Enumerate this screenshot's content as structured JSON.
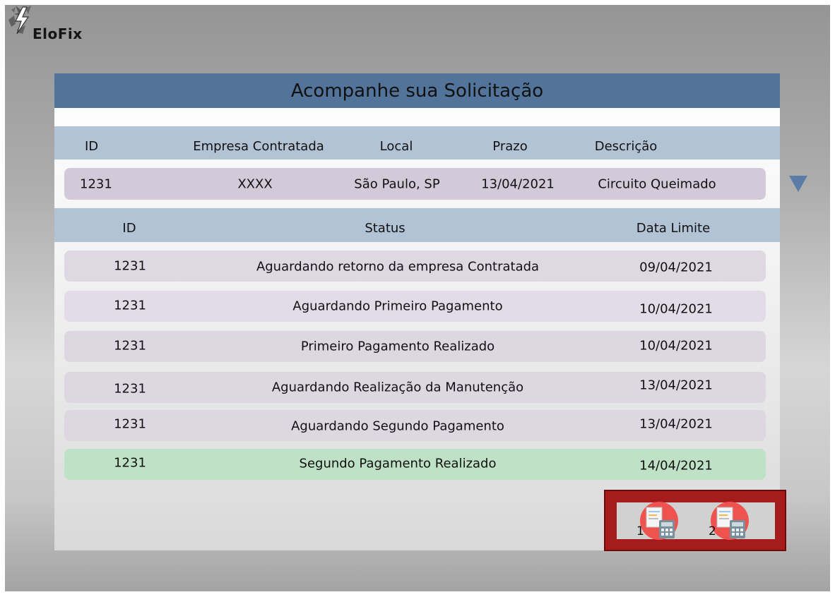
{
  "brand": {
    "name": "EloFix",
    "logo_icon": "lightning-bolt-icon"
  },
  "page": {
    "title": "Acompanhe sua Solicitação"
  },
  "request_table": {
    "columns": [
      "ID",
      "Empresa Contratada",
      "Local",
      "Prazo",
      "Descrição"
    ],
    "row": {
      "id": "1231",
      "empresa": "XXXX",
      "local": "São Paulo, SP",
      "prazo": "13/04/2021",
      "descricao": "Circuito Queimado"
    },
    "expand_icon": "triangle-down-icon"
  },
  "status_table": {
    "columns": [
      "ID",
      "Status",
      "Data Limite"
    ],
    "rows": [
      {
        "id": "1231",
        "status": "Aguardando retorno da empresa Contratada",
        "data": "09/04/2021"
      },
      {
        "id": "1231",
        "status": "Aguardando Primeiro Pagamento",
        "data": "10/04/2021"
      },
      {
        "id": "1231",
        "status": "Primeiro Pagamento Realizado",
        "data": "10/04/2021"
      },
      {
        "id": "1231",
        "status": "Aguardando Realização da Manutenção",
        "data": "13/04/2021"
      },
      {
        "id": "1231",
        "status": "Aguardando Segundo Pagamento",
        "data": "13/04/2021"
      },
      {
        "id": "1231",
        "status": "Segundo Pagamento Realizado",
        "data": "14/04/2021"
      }
    ]
  },
  "payments": {
    "icon": "invoice-calculator-icon",
    "buttons": [
      {
        "label": "1"
      },
      {
        "label": "2"
      }
    ]
  },
  "colors": {
    "title_bar": "#52739a",
    "header": "#b3c3d6",
    "row_request": "#d2cad9",
    "row_status": [
      "#ddd8e2",
      "#e2dce8",
      "#dcd7e1",
      "#ddd7e2",
      "#dcd7e1",
      "#bfe1c5"
    ],
    "action_box": "#a61b1b",
    "expand_arrow": "#5a7ca6"
  }
}
